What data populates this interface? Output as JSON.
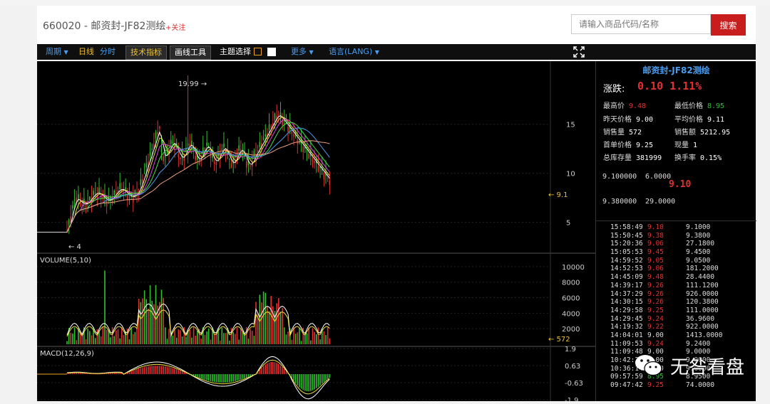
{
  "header": {
    "title": "660020 - 邮资封-JF82测绘",
    "follow": "+关注",
    "search_placeholder": "请输入商品代码/名称",
    "search_button": "搜索"
  },
  "toolbar": {
    "period": "周期",
    "daily": "日线",
    "minute": "分时",
    "tech": "技术指标",
    "draw": "画线工具",
    "theme": "主题选择",
    "more": "更多",
    "lang": "语言(LANG)"
  },
  "colors": {
    "accent": "#c81d1d",
    "up": "#e03030",
    "down": "#2fbf2f",
    "title_blue": "#4a9df0"
  },
  "icons": {
    "fullscreen": "expand-icon",
    "wechat": "wechat-icon"
  },
  "chart_data": [
    {
      "type": "line",
      "title": "",
      "yticks": [
        "15",
        "10",
        "5"
      ],
      "ylim": [
        2,
        21
      ],
      "annotations": [
        "19.99 →",
        "← 4",
        "← 9.1"
      ],
      "max_label_value": 19.99,
      "min_label_value": 4,
      "last_value": 9.1
    },
    {
      "type": "bar",
      "title": "VOLUME(5,10)",
      "yticks": [
        "10000",
        "8000",
        "6000",
        "4000",
        "2000"
      ],
      "ylim": [
        0,
        11000
      ],
      "last_value_label": "← 572",
      "last_value": 572
    },
    {
      "type": "bar",
      "title": "MACD(12,26,9)",
      "yticks": [
        "1.9",
        "0.63",
        "-0.63",
        "-1.9"
      ],
      "ylim": [
        -1.9,
        1.9
      ]
    }
  ],
  "quote": {
    "name": "邮资封-JF82测绘",
    "change_label": "涨跌:",
    "change_value": "0.10 1.11%",
    "high_label": "最高价",
    "high": "9.48",
    "low_label": "最低价格",
    "low": "8.95",
    "prev_label": "昨天价格",
    "prev": "9.00",
    "avg_label": "平均价格",
    "avg": "9.11",
    "vol_label": "销售量",
    "vol": "572",
    "amount_label": "销售额",
    "amount": "5212.95",
    "open_label": "首单价格",
    "open": "9.25",
    "cur_label": "现量",
    "cur": "1",
    "stock_label": "总库存量",
    "stock": "381999",
    "turnover_label": "换手率",
    "turnover": "0.15%"
  },
  "orderbook": {
    "ask_price": "9.100000",
    "ask_qty": "6.0000",
    "current": "9.10",
    "bid_price": "9.380000",
    "bid_qty": "29.0000"
  },
  "ticks": [
    {
      "t": "15:58:49",
      "p": "9.10",
      "q": "9.1000"
    },
    {
      "t": "15:50:45",
      "p": "9.38",
      "q": "9.3800"
    },
    {
      "t": "15:20:36",
      "p": "9.06",
      "q": "27.1800"
    },
    {
      "t": "15:05:53",
      "p": "9.45",
      "q": "9.4500"
    },
    {
      "t": "14:59:52",
      "p": "9.05",
      "q": "9.0500"
    },
    {
      "t": "14:52:53",
      "p": "9.06",
      "q": "181.2000"
    },
    {
      "t": "14:45:09",
      "p": "9.48",
      "q": "28.4400"
    },
    {
      "t": "14:39:17",
      "p": "9.26",
      "q": "111.1200"
    },
    {
      "t": "14:37:29",
      "p": "9.26",
      "q": "926.0000"
    },
    {
      "t": "14:30:15",
      "p": "9.26",
      "q": "120.3800"
    },
    {
      "t": "14:29:58",
      "p": "9.25",
      "q": "111.0000"
    },
    {
      "t": "14:29:45",
      "p": "9.24",
      "q": "36.9600"
    },
    {
      "t": "14:19:32",
      "p": "9.22",
      "q": "922.0000"
    },
    {
      "t": "14:04:01",
      "p": "9.00",
      "q": "1413.0000"
    },
    {
      "t": "11:09:53",
      "p": "9.24",
      "q": "9.2400"
    },
    {
      "t": "11:09:48",
      "p": "9.00",
      "q": "9.0000"
    },
    {
      "t": "10:42:27",
      "p": "9.00",
      "q": "9.0000"
    },
    {
      "t": "10:36:14",
      "p": "9.00",
      "q": "9.0000"
    },
    {
      "t": "09:57:59",
      "p": "8.95",
      "q": "8.9500"
    },
    {
      "t": "09:47:42",
      "p": "9.25",
      "q": "74.0000"
    }
  ],
  "watermark": "无咎看盘"
}
